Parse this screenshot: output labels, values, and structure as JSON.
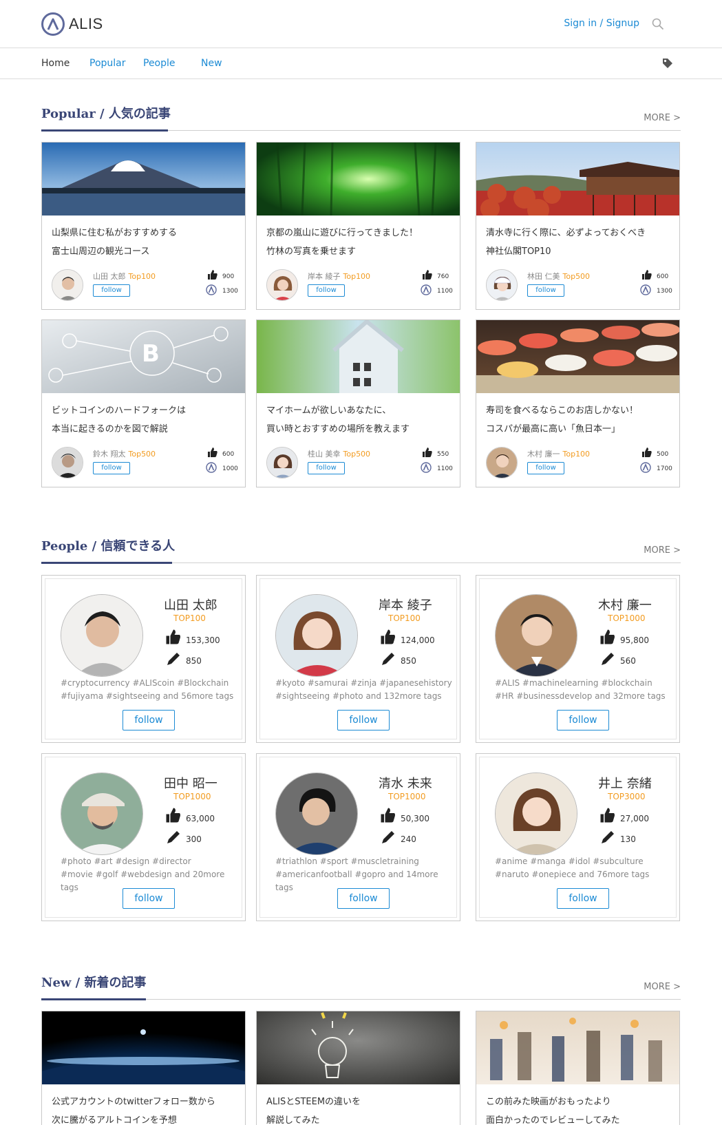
{
  "header": {
    "logo_text": "ALIS",
    "signin_label": "Sign in / Signup"
  },
  "nav": {
    "items": [
      "Home",
      "Popular",
      "People",
      "New"
    ]
  },
  "popular": {
    "title": "Popular / 人気の記事",
    "more": "MORE >",
    "articles": [
      {
        "title1": "山梨県に住む私がおすすめする",
        "title2": "富士山周辺の観光コース",
        "author": "山田 太郎",
        "rank": "Top100",
        "follow": "follow",
        "likes": "900",
        "tokens": "1300"
      },
      {
        "title1": "京都の嵐山に遊びに行ってきました！",
        "title2": "竹林の写真を乗せます",
        "author": "岸本 綾子",
        "rank": "Top100",
        "follow": "follow",
        "likes": "760",
        "tokens": "1100"
      },
      {
        "title1": "清水寺に行く際に、必ずよっておくべき",
        "title2": "神社仏閣TOP10",
        "author": "林田 仁美",
        "rank": "Top500",
        "follow": "follow",
        "likes": "600",
        "tokens": "1300"
      },
      {
        "title1": "ビットコインのハードフォークは",
        "title2": "本当に起きるのかを図で解説",
        "author": "鈴木 翔太",
        "rank": "Top500",
        "follow": "follow",
        "likes": "600",
        "tokens": "1000"
      },
      {
        "title1": "マイホームが欲しいあなたに、",
        "title2": "買い時とおすすめの場所を教えます",
        "author": "桂山 美幸",
        "rank": "Top500",
        "follow": "follow",
        "likes": "550",
        "tokens": "1100"
      },
      {
        "title1": "寿司を食べるならこのお店しかない！",
        "title2": "コスパが最高に高い「魚日本一」",
        "author": "木村 廉一",
        "rank": "Top100",
        "follow": "follow",
        "likes": "500",
        "tokens": "1700"
      }
    ]
  },
  "people": {
    "title": "People / 信頼できる人",
    "more": "MORE >",
    "persons": [
      {
        "name": "山田 太郎",
        "rank": "TOP100",
        "likes": "153,300",
        "posts": "850",
        "tags1": "#cryptocurrency #ALIScoin #Blockchain",
        "tags2": "#fujiyama #sightseeing and 56more tags",
        "follow": "follow"
      },
      {
        "name": "岸本 綾子",
        "rank": "TOP100",
        "likes": "124,000",
        "posts": "850",
        "tags1": "#kyoto #samurai #zinja #japanesehistory",
        "tags2": "#sightseeing #photo and 132more tags",
        "follow": "follow"
      },
      {
        "name": "木村 廉一",
        "rank": "TOP1000",
        "likes": "95,800",
        "posts": "560",
        "tags1": "#ALIS #machinelearning #blockchain",
        "tags2": "#HR #businessdevelop and 32more tags",
        "follow": "follow"
      },
      {
        "name": "田中 昭一",
        "rank": "TOP1000",
        "likes": "63,000",
        "posts": "300",
        "tags1": "#photo #art #design #director",
        "tags2": "#movie #golf #webdesign and 20more tags",
        "follow": "follow"
      },
      {
        "name": "清水 未来",
        "rank": "TOP1000",
        "likes": "50,300",
        "posts": "240",
        "tags1": "#triathlon #sport #muscletraining",
        "tags2": "#americanfootball #gopro and 14more tags",
        "follow": "follow"
      },
      {
        "name": "井上 奈緒",
        "rank": "TOP3000",
        "likes": "27,000",
        "posts": "130",
        "tags1": "#anime #manga #idol #subculture",
        "tags2": "#naruto #onepiece and 76more tags",
        "follow": "follow"
      }
    ]
  },
  "newsec": {
    "title": "New / 新着の記事",
    "more": "MORE >",
    "articles": [
      {
        "title1": "公式アカウントのtwitterフォロー数から",
        "title2": "次に騰がるアルトコインを予想"
      },
      {
        "title1": "ALISとSTEEMの違いを",
        "title2": "解説してみた"
      },
      {
        "title1": "この前みた映画がおもったより",
        "title2": "面白かったのでレビューしてみた"
      }
    ]
  },
  "colors": {
    "brand": "#3a4676",
    "link": "#1b8ad4",
    "rank": "#f29b1f"
  }
}
